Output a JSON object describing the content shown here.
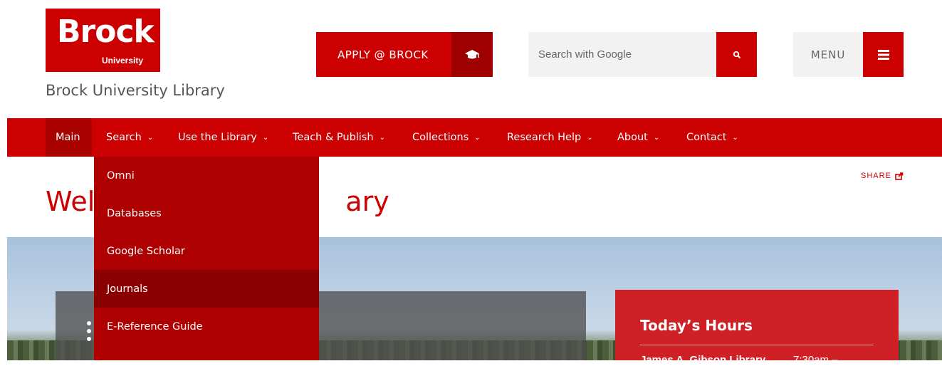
{
  "header": {
    "logo": {
      "wordmark": "Brock",
      "sub": "University"
    },
    "site_title": "Brock University Library",
    "apply_label": "APPLY @ BROCK",
    "search_placeholder": "Search with Google",
    "menu_label": "MENU"
  },
  "nav": {
    "items": [
      {
        "label": "Main",
        "has_dropdown": false
      },
      {
        "label": "Search",
        "has_dropdown": true
      },
      {
        "label": "Use the Library",
        "has_dropdown": true
      },
      {
        "label": "Teach & Publish",
        "has_dropdown": true
      },
      {
        "label": "Collections",
        "has_dropdown": true
      },
      {
        "label": "Research Help",
        "has_dropdown": true
      },
      {
        "label": "About",
        "has_dropdown": true
      },
      {
        "label": "Contact",
        "has_dropdown": true
      }
    ],
    "chevron": "⌄"
  },
  "dropdown": {
    "items": [
      {
        "label": "Omni"
      },
      {
        "label": "Databases"
      },
      {
        "label": "Google Scholar"
      },
      {
        "label": "Journals",
        "highlighted": true
      },
      {
        "label": "E-Reference Guide"
      }
    ]
  },
  "page": {
    "share_label": "SHARE",
    "welcome_left": "Wel",
    "welcome_right": "ary"
  },
  "hours": {
    "title": "Today’s Hours",
    "location": "James A. Gibson Library",
    "time": "7:30am –"
  },
  "colors": {
    "brand_red": "#cc0000",
    "nav_active": "#a90000",
    "dropdown_bg": "#ae0000",
    "dropdown_highlight": "#8a0000",
    "hours_bg": "#cf2026"
  },
  "icons": {
    "apply": "graduation-cap-icon",
    "search": "search-icon",
    "menu": "hamburger-menu-icon",
    "share": "share-icon",
    "carousel": "carousel-dots-icon"
  }
}
